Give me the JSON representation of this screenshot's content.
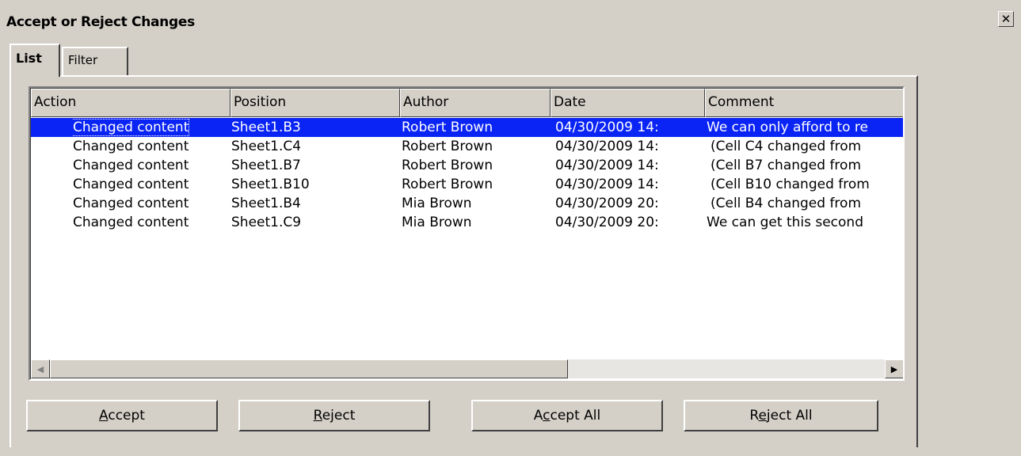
{
  "window": {
    "title": "Accept or Reject Changes",
    "close_symbol": "✕"
  },
  "tabs": [
    {
      "label": "List",
      "active": true
    },
    {
      "label": "Filter",
      "active": false
    }
  ],
  "table": {
    "columns": [
      "Action",
      "Position",
      "Author",
      "Date",
      "Comment"
    ],
    "rows": [
      {
        "action": "Changed content",
        "position": "Sheet1.B3",
        "author": "Robert Brown",
        "date": "04/30/2009 14:",
        "comment": "We can only afford to re",
        "selected": true
      },
      {
        "action": "Changed content",
        "position": "Sheet1.C4",
        "author": "Robert Brown",
        "date": "04/30/2009 14:",
        "comment": "(Cell C4 changed from",
        "selected": false
      },
      {
        "action": "Changed content",
        "position": "Sheet1.B7",
        "author": "Robert Brown",
        "date": "04/30/2009 14:",
        "comment": "(Cell B7 changed from",
        "selected": false
      },
      {
        "action": "Changed content",
        "position": "Sheet1.B10",
        "author": "Robert Brown",
        "date": "04/30/2009 14:",
        "comment": "(Cell B10 changed from",
        "selected": false
      },
      {
        "action": "Changed content",
        "position": "Sheet1.B4",
        "author": "Mia Brown",
        "date": "04/30/2009 20:",
        "comment": "(Cell B4 changed from",
        "selected": false
      },
      {
        "action": "Changed content",
        "position": "Sheet1.C9",
        "author": "Mia Brown",
        "date": "04/30/2009 20:",
        "comment": "We can get this second",
        "selected": false
      }
    ]
  },
  "buttons": {
    "accept": {
      "pre": "",
      "mnemonic": "A",
      "post": "ccept"
    },
    "reject": {
      "pre": "",
      "mnemonic": "R",
      "post": "eject"
    },
    "accept_all": {
      "pre": "A",
      "mnemonic": "c",
      "post": "cept All"
    },
    "reject_all": {
      "pre": "R",
      "mnemonic": "e",
      "post": "ject All"
    }
  },
  "icons": {
    "scroll_left": "◀",
    "scroll_right": "▶"
  },
  "colors": {
    "selection": "#0a24f5",
    "dialog_bg": "#d4d0c8"
  }
}
